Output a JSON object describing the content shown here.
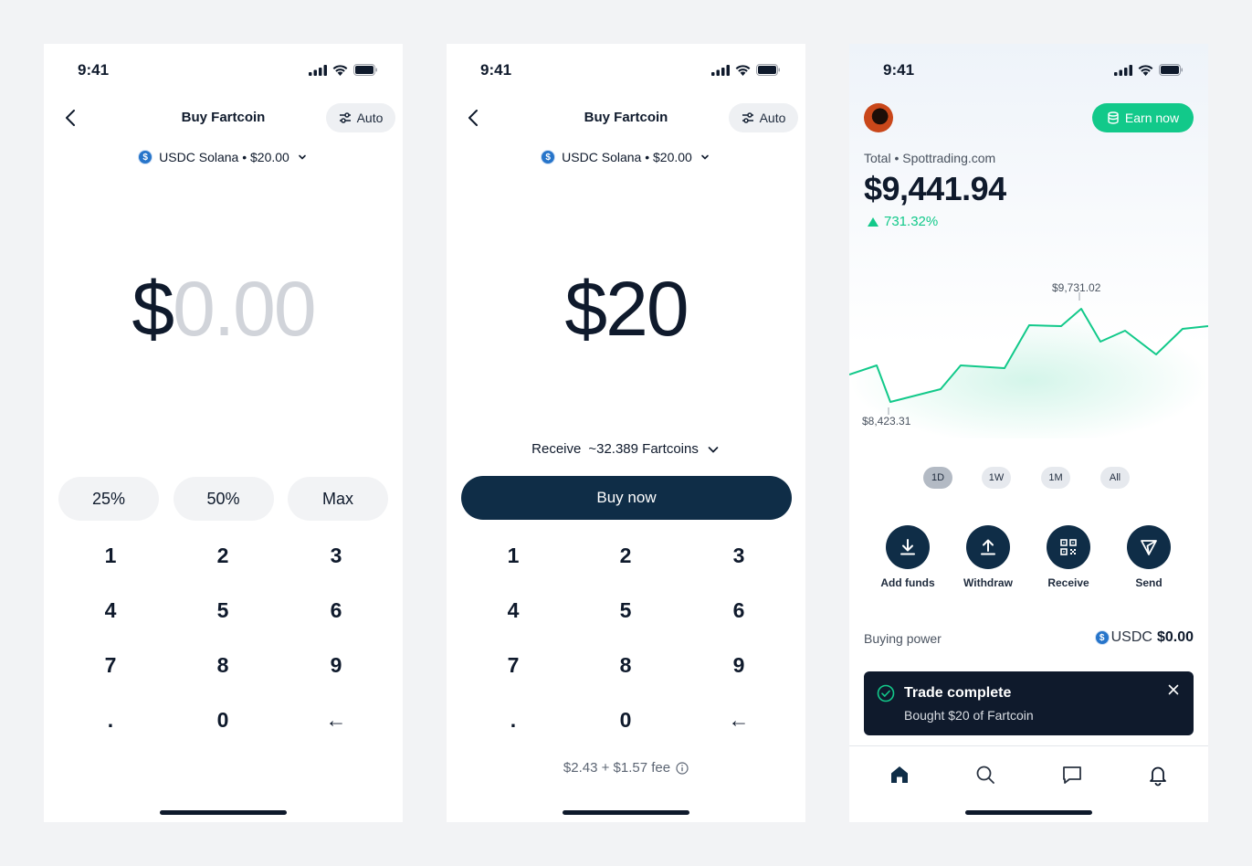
{
  "status": {
    "time": "9:41"
  },
  "screen1": {
    "title": "Buy Fartcoin",
    "auto_label": "Auto",
    "asset_label": "USDC Solana • $20.00",
    "amount_prefix": "$",
    "amount_placeholder": "0.00",
    "percent_buttons": [
      "25%",
      "50%",
      "Max"
    ],
    "keys": [
      "1",
      "2",
      "3",
      "4",
      "5",
      "6",
      "7",
      "8",
      "9",
      ".",
      "0",
      "←"
    ]
  },
  "screen2": {
    "title": "Buy Fartcoin",
    "auto_label": "Auto",
    "asset_label": "USDC Solana • $20.00",
    "amount": "$20",
    "receive_label": "Receive",
    "receive_value": "~32.389 Fartcoins",
    "buy_label": "Buy now",
    "fee_text": "$2.43 + $1.57 fee",
    "keys": [
      "1",
      "2",
      "3",
      "4",
      "5",
      "6",
      "7",
      "8",
      "9",
      ".",
      "0",
      "←"
    ]
  },
  "screen3": {
    "earn_label": "Earn now",
    "total_label": "Total • Spottrading.com",
    "total_value": "$9,441.94",
    "change": "731.32%",
    "chart_high_label": "$9,731.02",
    "chart_low_label": "$8,423.31",
    "ranges": [
      "1D",
      "1W",
      "1M",
      "All"
    ],
    "active_range": "1D",
    "actions": [
      {
        "label": "Add funds",
        "icon": "download-icon"
      },
      {
        "label": "Withdraw",
        "icon": "upload-icon"
      },
      {
        "label": "Receive",
        "icon": "qr-code-icon"
      },
      {
        "label": "Send",
        "icon": "send-icon"
      }
    ],
    "buying_power_label": "Buying power",
    "buying_power_currency": "USDC",
    "buying_power_value": "$0.00",
    "toast_title": "Trade complete",
    "toast_subtitle": "Bought $20 of Fartcoin",
    "nav": [
      "home-icon",
      "search-icon",
      "chat-icon",
      "bell-icon"
    ],
    "colors": {
      "accent": "#12c98a",
      "navy": "#0f2d47",
      "usdc": "#2775ca"
    }
  }
}
